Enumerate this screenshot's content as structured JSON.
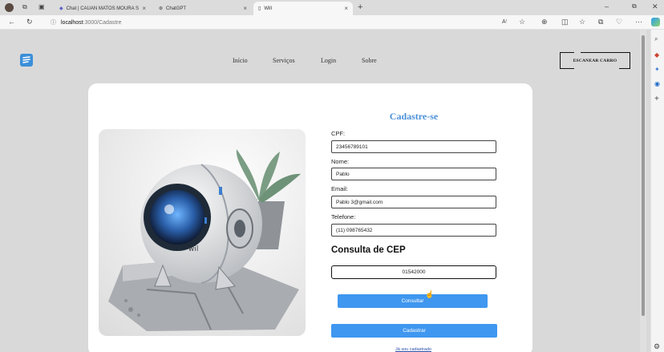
{
  "browser": {
    "tabs": [
      {
        "label": "Chat | CAUAN MATOS MOURA S"
      },
      {
        "label": "ChatGPT"
      },
      {
        "label": "Will"
      }
    ],
    "url_host": "localhost",
    "url_path": ":3000/Cadastre",
    "read_aloud": "A⁾"
  },
  "header": {
    "nav": [
      "Início",
      "Serviços",
      "Login",
      "Sobre"
    ],
    "scan_button": "ESCANEAR CARRO"
  },
  "form": {
    "title": "Cadastre-se",
    "fields": [
      {
        "label": "CPF:",
        "value": "23456789101"
      },
      {
        "label": "Nome:",
        "value": "Pablo"
      },
      {
        "label": "Email:",
        "value": "Pablo 3@gmail.com"
      },
      {
        "label": "Telefone:",
        "value": "(11) 098765432"
      }
    ],
    "cep_title": "Consulta de CEP",
    "cep_value": "01542000",
    "consult_button": "Consultar",
    "register_button": "Cadastrar",
    "already_link": "Já sou cadastrado"
  },
  "image": {
    "robot_label": "wil"
  },
  "colors": {
    "accent": "#3f97ef",
    "title": "#4a90d9",
    "background": "#d9d9d9",
    "card": "#ffffff"
  }
}
